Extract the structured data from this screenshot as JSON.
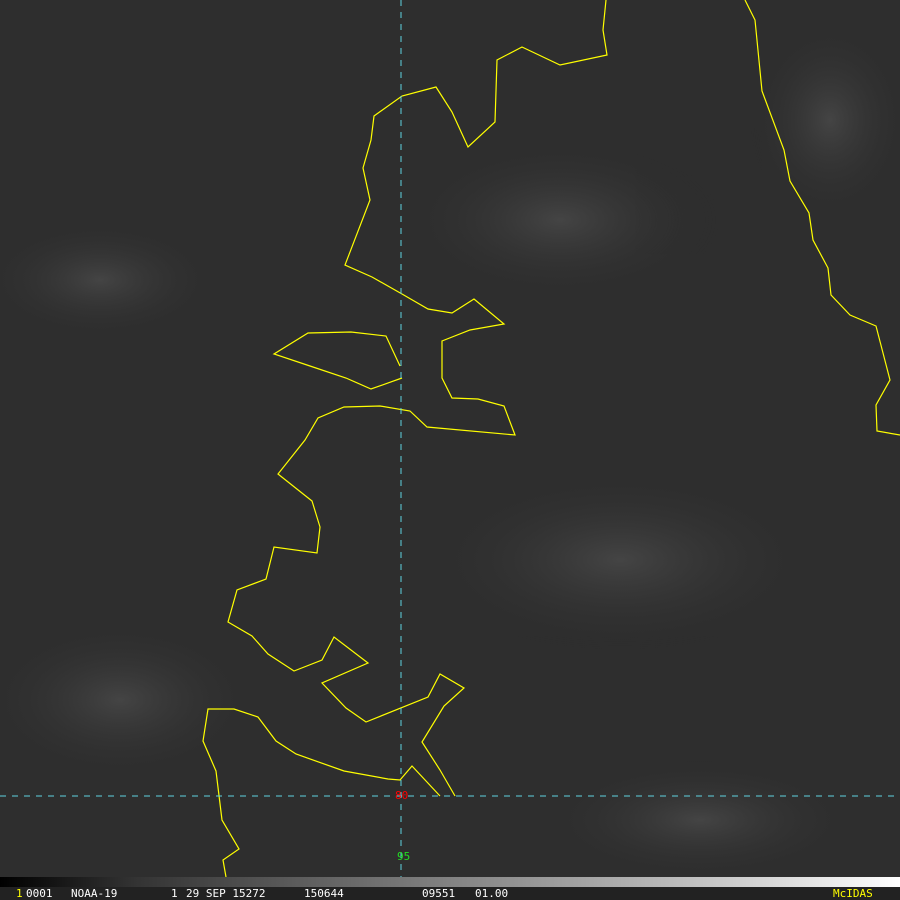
{
  "image": {
    "frame_number": "1",
    "frame_id": "0001",
    "satellite": "NOAA-19",
    "band": "1",
    "date": "29 SEP 15272",
    "time": "150644",
    "field1": "09551",
    "field2": "01.00",
    "software": "McIDAS"
  },
  "grid_labels": {
    "latitude": "80",
    "longitude": "95"
  },
  "colors": {
    "coastline": "#ffff00",
    "grid": "#5fd3e0",
    "lat_label": "#ff0000",
    "lon_label": "#22dd22",
    "logo": "#ffff00"
  }
}
